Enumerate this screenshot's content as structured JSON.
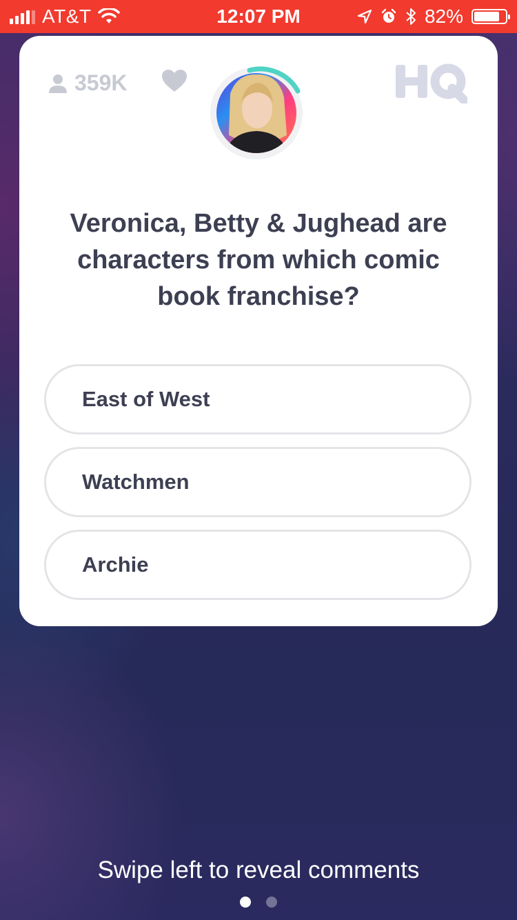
{
  "status_bar": {
    "carrier": "AT&T",
    "time": "12:07 PM",
    "battery_percent": "82%",
    "battery_level": 0.82,
    "icons": [
      "signal-bars-icon",
      "wifi-icon",
      "location-arrow-icon",
      "alarm-icon",
      "bluetooth-icon",
      "battery-icon"
    ]
  },
  "header": {
    "viewer_count": "359K",
    "logo_text": "HQ",
    "icons": [
      "person-icon",
      "heart-icon"
    ]
  },
  "host": {
    "icon": "host-avatar",
    "timer_ring_color": "#4fd3c4"
  },
  "question": {
    "text": "Veronica, Betty & Jughead are characters from which comic book franchise?"
  },
  "answers": [
    {
      "label": "East of West"
    },
    {
      "label": "Watchmen"
    },
    {
      "label": "Archie"
    }
  ],
  "footer": {
    "hint": "Swipe left to reveal comments",
    "page_index": 1,
    "page_count": 2
  },
  "colors": {
    "status_bar": "#f23a2f",
    "card": "#ffffff",
    "text_dark": "#3d3f52",
    "muted": "#c8cad3",
    "answer_border": "#e4e4e8"
  }
}
